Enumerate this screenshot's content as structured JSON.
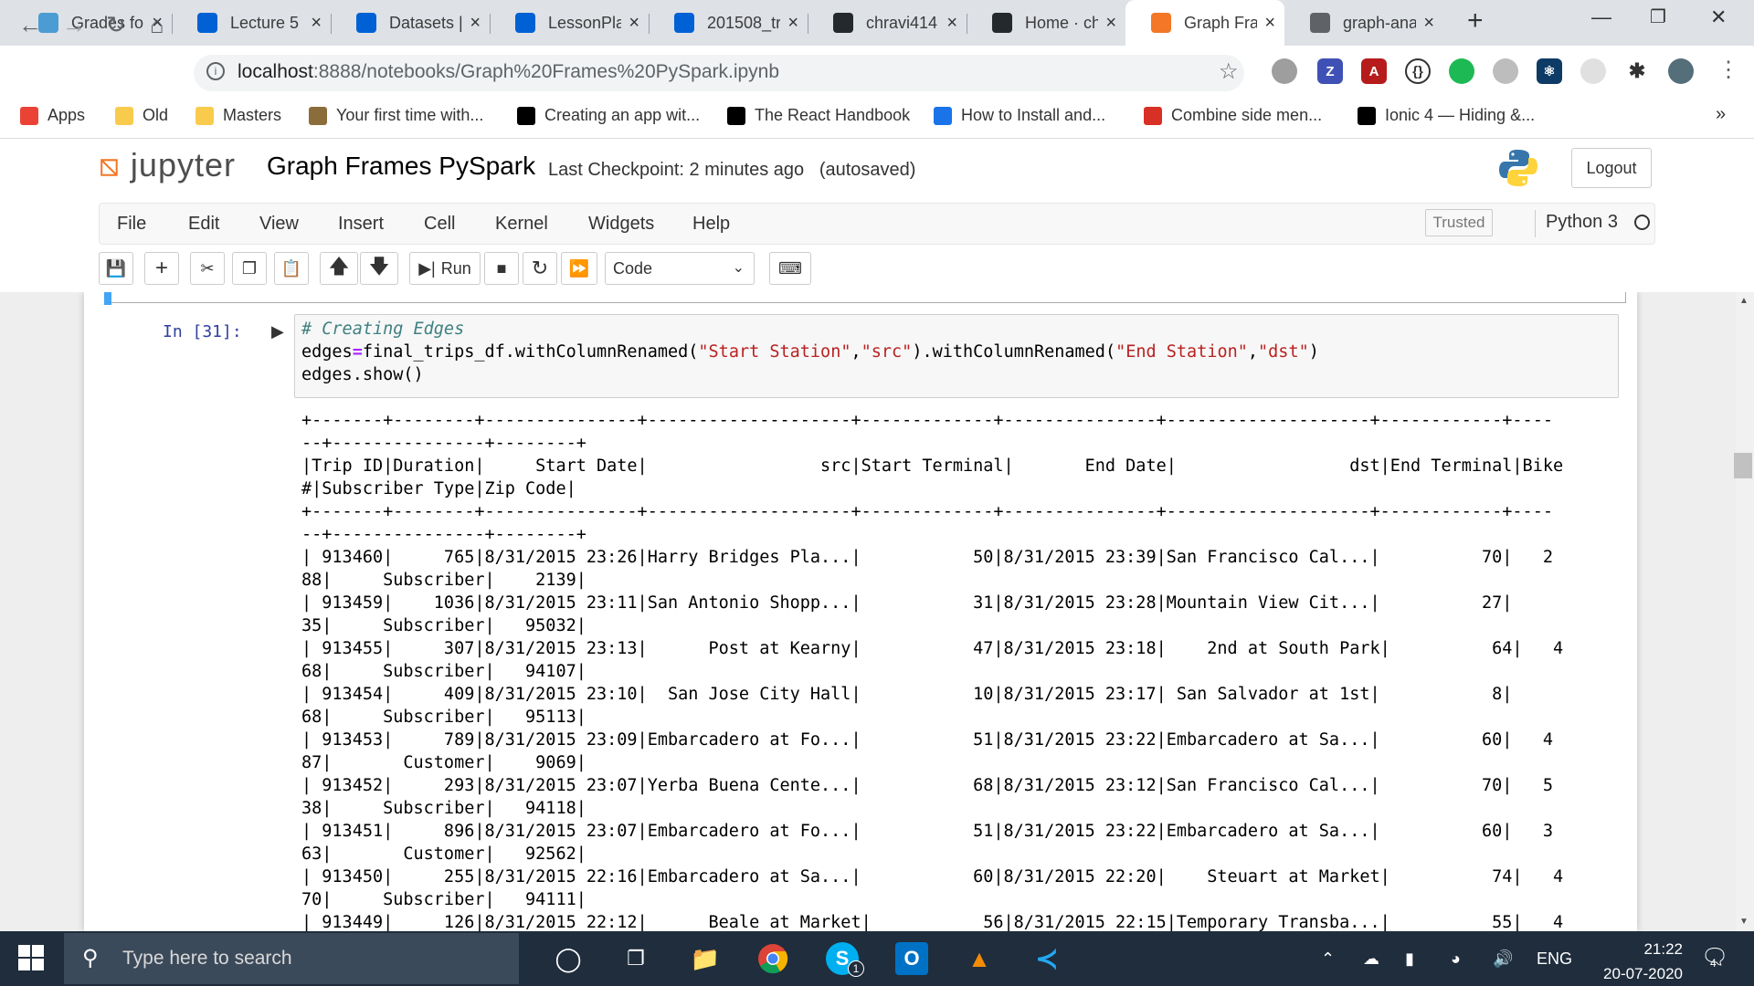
{
  "browser": {
    "tabs": [
      {
        "title": "Grades fo",
        "icon": "unc-icon",
        "color": "#4b9cd3"
      },
      {
        "title": "Lecture 5",
        "icon": "box-icon",
        "color": "#0061d5"
      },
      {
        "title": "Datasets |",
        "icon": "box-icon",
        "color": "#0061d5"
      },
      {
        "title": "LessonPla",
        "icon": "box-icon",
        "color": "#0061d5"
      },
      {
        "title": "201508_tr",
        "icon": "box-icon",
        "color": "#0061d5"
      },
      {
        "title": "chravi414",
        "icon": "github-icon",
        "color": "#24292e"
      },
      {
        "title": "Home · ch",
        "icon": "github-icon",
        "color": "#24292e"
      },
      {
        "title": "Graph Fra",
        "icon": "jupyter-icon",
        "color": "#f37726"
      },
      {
        "title": "graph-ana",
        "icon": "globe-icon",
        "color": "#5f6368"
      }
    ],
    "url_host": "localhost",
    "url_path": ":8888/notebooks/Graph%20Frames%20PySpark.ipynb",
    "bookmarks": [
      {
        "label": "Apps",
        "color": "#ea4335"
      },
      {
        "label": "Old",
        "color": "#f9cb4d"
      },
      {
        "label": "Masters",
        "color": "#f9cb4d"
      },
      {
        "label": "Your first time with...",
        "color": "#8a6d3b"
      },
      {
        "label": "Creating an app wit...",
        "color": "#000000"
      },
      {
        "label": "The React Handbook",
        "color": "#000000"
      },
      {
        "label": "How to Install and...",
        "color": "#1a73e8"
      },
      {
        "label": "Combine side men...",
        "color": "#d93025"
      },
      {
        "label": "Ionic 4 — Hiding &...",
        "color": "#000000"
      }
    ],
    "more_bookmarks": "»"
  },
  "jupyter": {
    "logo_text": "jupyter",
    "notebook_name": "Graph Frames PySpark",
    "checkpoint": "Last Checkpoint: 2 minutes ago",
    "autosave": "(autosaved)",
    "logout": "Logout",
    "menus": [
      "File",
      "Edit",
      "View",
      "Insert",
      "Cell",
      "Kernel",
      "Widgets",
      "Help"
    ],
    "trusted": "Trusted",
    "kernel": "Python 3",
    "run_label": "Run",
    "cell_type": "Code"
  },
  "cell": {
    "prompt": "In [31]:",
    "comment": "# Creating Edges",
    "line2_a": "edges",
    "line2_eq": "=",
    "line2_b": "final_trips_df.withColumnRenamed(",
    "line2_s1": "\"Start Station\"",
    "line2_c1": ",",
    "line2_s2": "\"src\"",
    "line2_c2": ").withColumnRenamed(",
    "line2_s3": "\"End Station\"",
    "line2_c3": ",",
    "line2_s4": "\"dst\"",
    "line2_c4": ")",
    "line3": "edges.show()"
  },
  "output_lines": [
    "+-------+--------+---------------+--------------------+-------------+---------------+--------------------+------------+----",
    "--+---------------+--------+",
    "|Trip ID|Duration|     Start Date|                 src|Start Terminal|       End Date|                 dst|End Terminal|Bike",
    "#|Subscriber Type|Zip Code|",
    "+-------+--------+---------------+--------------------+-------------+---------------+--------------------+------------+----",
    "--+---------------+--------+",
    "| 913460|     765|8/31/2015 23:26|Harry Bridges Pla...|           50|8/31/2015 23:39|San Francisco Cal...|          70|   2",
    "88|     Subscriber|    2139|",
    "| 913459|    1036|8/31/2015 23:11|San Antonio Shopp...|           31|8/31/2015 23:28|Mountain View Cit...|          27|",
    "35|     Subscriber|   95032|",
    "| 913455|     307|8/31/2015 23:13|      Post at Kearny|           47|8/31/2015 23:18|    2nd at South Park|          64|   4",
    "68|     Subscriber|   94107|",
    "| 913454|     409|8/31/2015 23:10|  San Jose City Hall|           10|8/31/2015 23:17| San Salvador at 1st|           8|",
    "68|     Subscriber|   95113|",
    "| 913453|     789|8/31/2015 23:09|Embarcadero at Fo...|           51|8/31/2015 23:22|Embarcadero at Sa...|          60|   4",
    "87|       Customer|    9069|",
    "| 913452|     293|8/31/2015 23:07|Yerba Buena Cente...|           68|8/31/2015 23:12|San Francisco Cal...|          70|   5",
    "38|     Subscriber|   94118|",
    "| 913451|     896|8/31/2015 23:07|Embarcadero at Fo...|           51|8/31/2015 23:22|Embarcadero at Sa...|          60|   3",
    "63|       Customer|   92562|",
    "| 913450|     255|8/31/2015 22:16|Embarcadero at Sa...|           60|8/31/2015 22:20|    Steuart at Market|          74|   4",
    "70|     Subscriber|   94111|",
    "| 913449|     126|8/31/2015 22:12|      Beale at Market|           56|8/31/2015 22:15|Temporary Transba...|          55|   4"
  ],
  "taskbar": {
    "search_placeholder": "Type here to search",
    "lang": "ENG",
    "time": "21:22",
    "date": "20-07-2020",
    "notif_count": "4",
    "skype_badge": "1"
  }
}
